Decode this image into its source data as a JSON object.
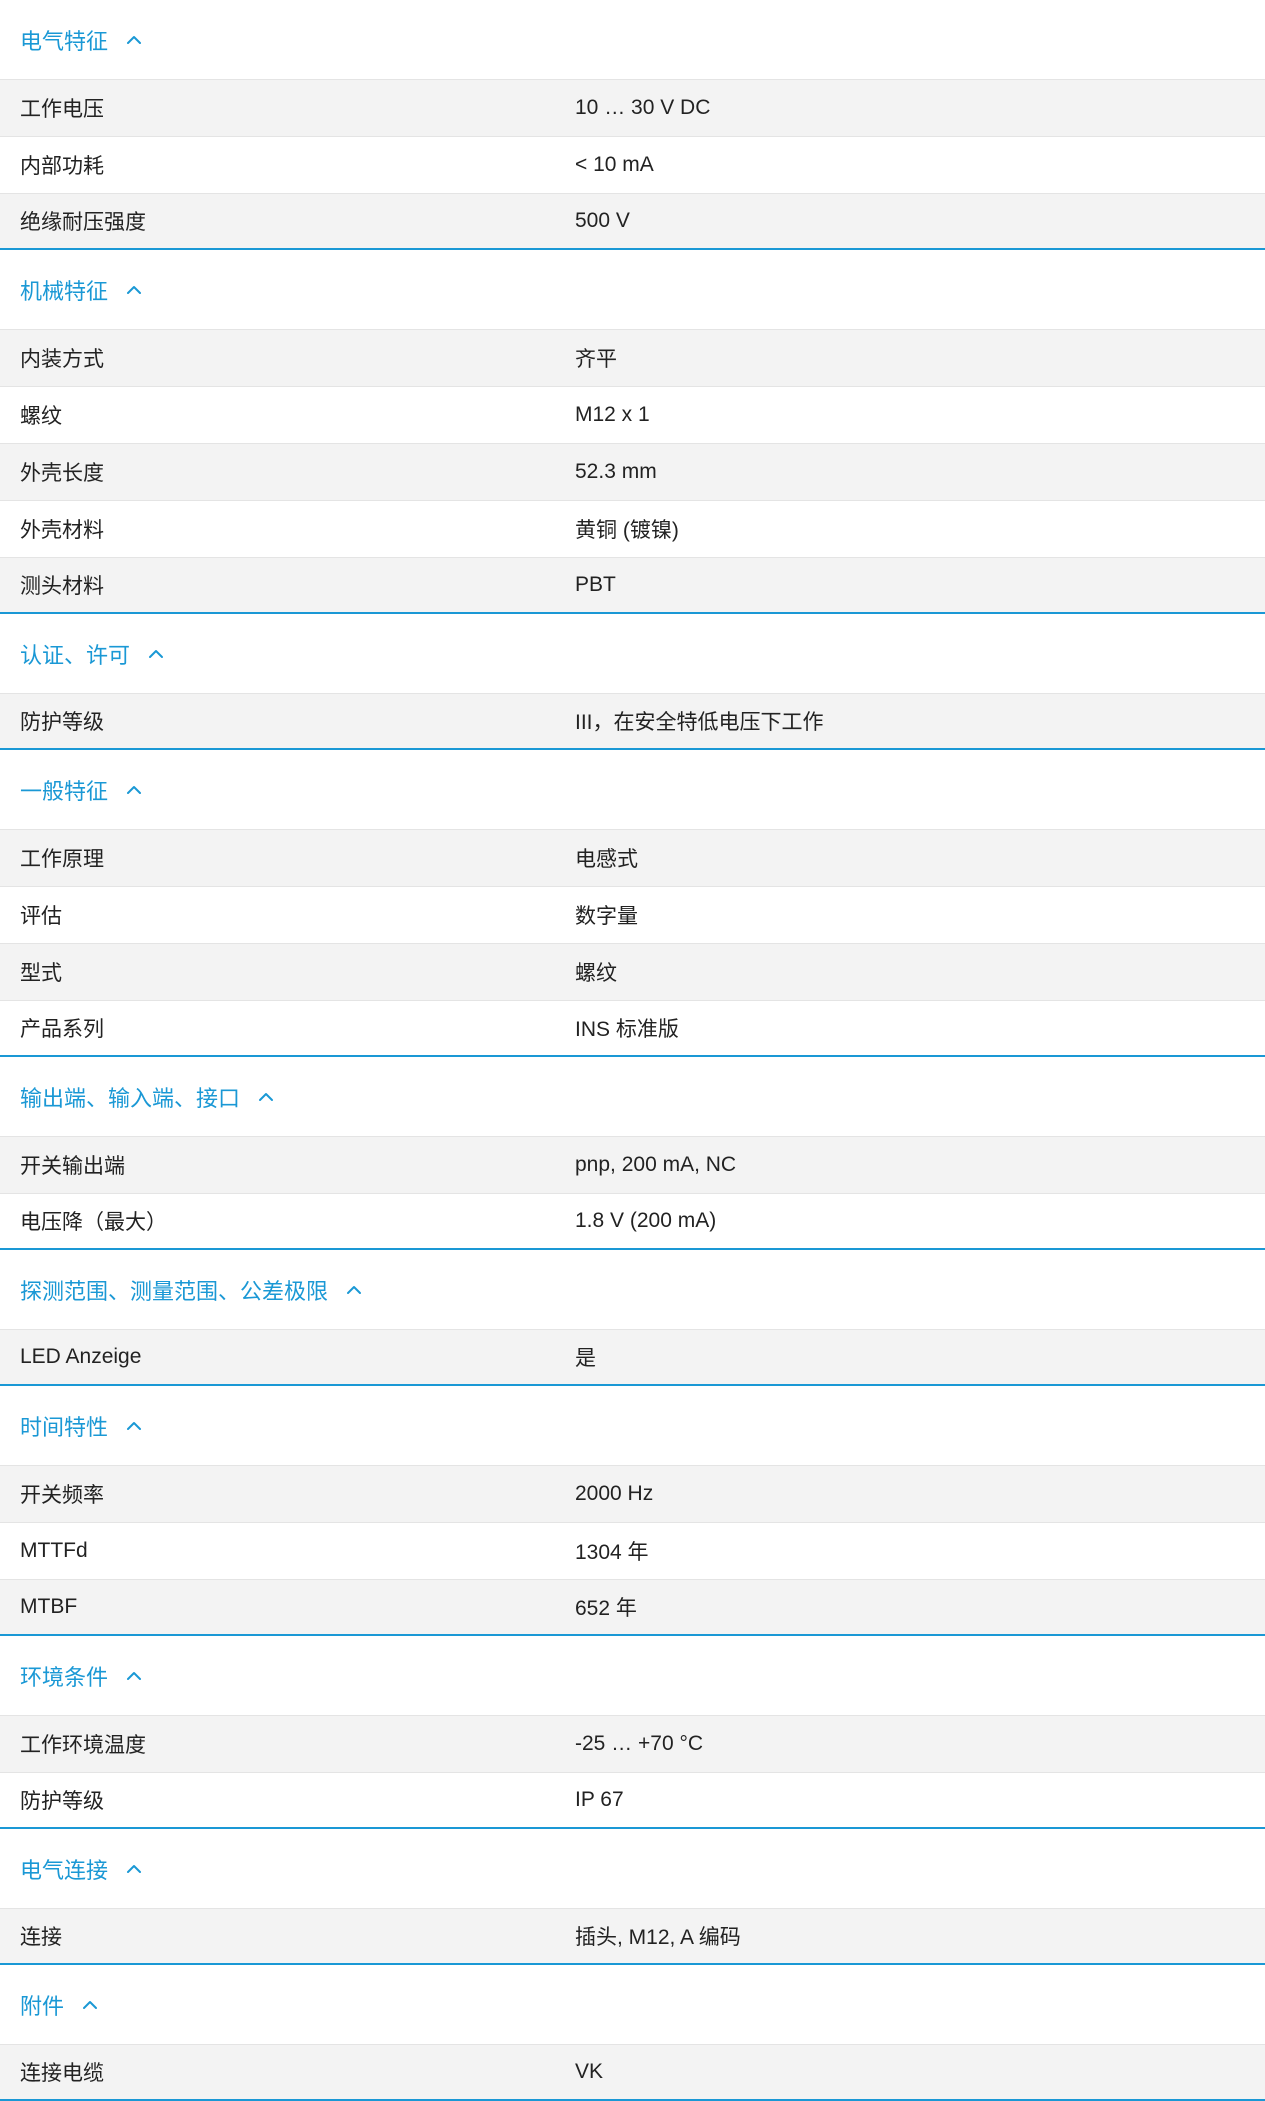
{
  "accent_color": "#1a98d5",
  "chevron_icon": "chevron-up-icon",
  "sections": [
    {
      "title": "电气特征",
      "rows": [
        {
          "label": "工作电压",
          "value": "10 … 30 V DC"
        },
        {
          "label": "内部功耗",
          "value": "< 10 mA"
        },
        {
          "label": "绝缘耐压强度",
          "value": "500 V"
        }
      ]
    },
    {
      "title": "机械特征",
      "rows": [
        {
          "label": "内装方式",
          "value": "齐平"
        },
        {
          "label": "螺纹",
          "value": "M12 x 1"
        },
        {
          "label": "外壳长度",
          "value": "52.3 mm"
        },
        {
          "label": "外壳材料",
          "value": "黄铜 (镀镍)"
        },
        {
          "label": "测头材料",
          "value": "PBT"
        }
      ]
    },
    {
      "title": "认证、许可",
      "rows": [
        {
          "label": "防护等级",
          "value": "III，在安全特低电压下工作"
        }
      ]
    },
    {
      "title": "一般特征",
      "rows": [
        {
          "label": "工作原理",
          "value": "电感式"
        },
        {
          "label": "评估",
          "value": "数字量"
        },
        {
          "label": "型式",
          "value": "螺纹"
        },
        {
          "label": "产品系列",
          "value": "INS 标准版"
        }
      ]
    },
    {
      "title": "输出端、输入端、接口",
      "rows": [
        {
          "label": "开关输出端",
          "value": "pnp, 200 mA, NC"
        },
        {
          "label": "电压降（最大）",
          "value": "1.8 V (200 mA)"
        }
      ]
    },
    {
      "title": "探测范围、测量范围、公差极限",
      "rows": [
        {
          "label": "LED Anzeige",
          "value": "是"
        }
      ]
    },
    {
      "title": "时间特性",
      "rows": [
        {
          "label": "开关频率",
          "value": "2000 Hz"
        },
        {
          "label": "MTTFd",
          "value": "1304 年"
        },
        {
          "label": "MTBF",
          "value": "652 年"
        }
      ]
    },
    {
      "title": "环境条件",
      "rows": [
        {
          "label": "工作环境温度",
          "value": "-25 … +70 °C"
        },
        {
          "label": "防护等级",
          "value": "IP 67"
        }
      ]
    },
    {
      "title": "电气连接",
      "rows": [
        {
          "label": "连接",
          "value": "插头, M12, A 编码"
        }
      ]
    },
    {
      "title": "附件",
      "rows": [
        {
          "label": "连接电缆",
          "value": "VK"
        }
      ]
    }
  ]
}
